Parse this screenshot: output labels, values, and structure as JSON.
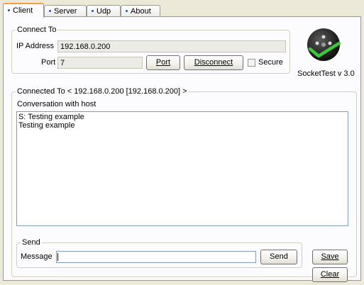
{
  "tabs": [
    "Client",
    "Server",
    "Udp",
    "About"
  ],
  "connect_to": {
    "legend": "Connect To",
    "ip_label": "IP Address",
    "ip_value": "192.168.0.200",
    "port_label": "Port",
    "port_value": "7",
    "port_button": "Port",
    "disconnect_button": "Disconnect",
    "secure_label": "Secure",
    "secure_checked": false
  },
  "branding": {
    "version": "SocketTest v 3.0"
  },
  "connected": {
    "legend": "Connected To <  192.168.0.200 [192.168.0.200]  >",
    "conversation_label": "Conversation with host",
    "lines": [
      "S: Testing example",
      "Testing example"
    ]
  },
  "send": {
    "legend": "Send",
    "message_label": "Message",
    "message_value": "",
    "send_button": "Send"
  },
  "buttons": {
    "save": "Save",
    "clear": "Clear"
  },
  "colors": {
    "accent_tab": "#f0a33c",
    "dot": "#1b4fc2",
    "logo_check": "#3cc83c"
  }
}
